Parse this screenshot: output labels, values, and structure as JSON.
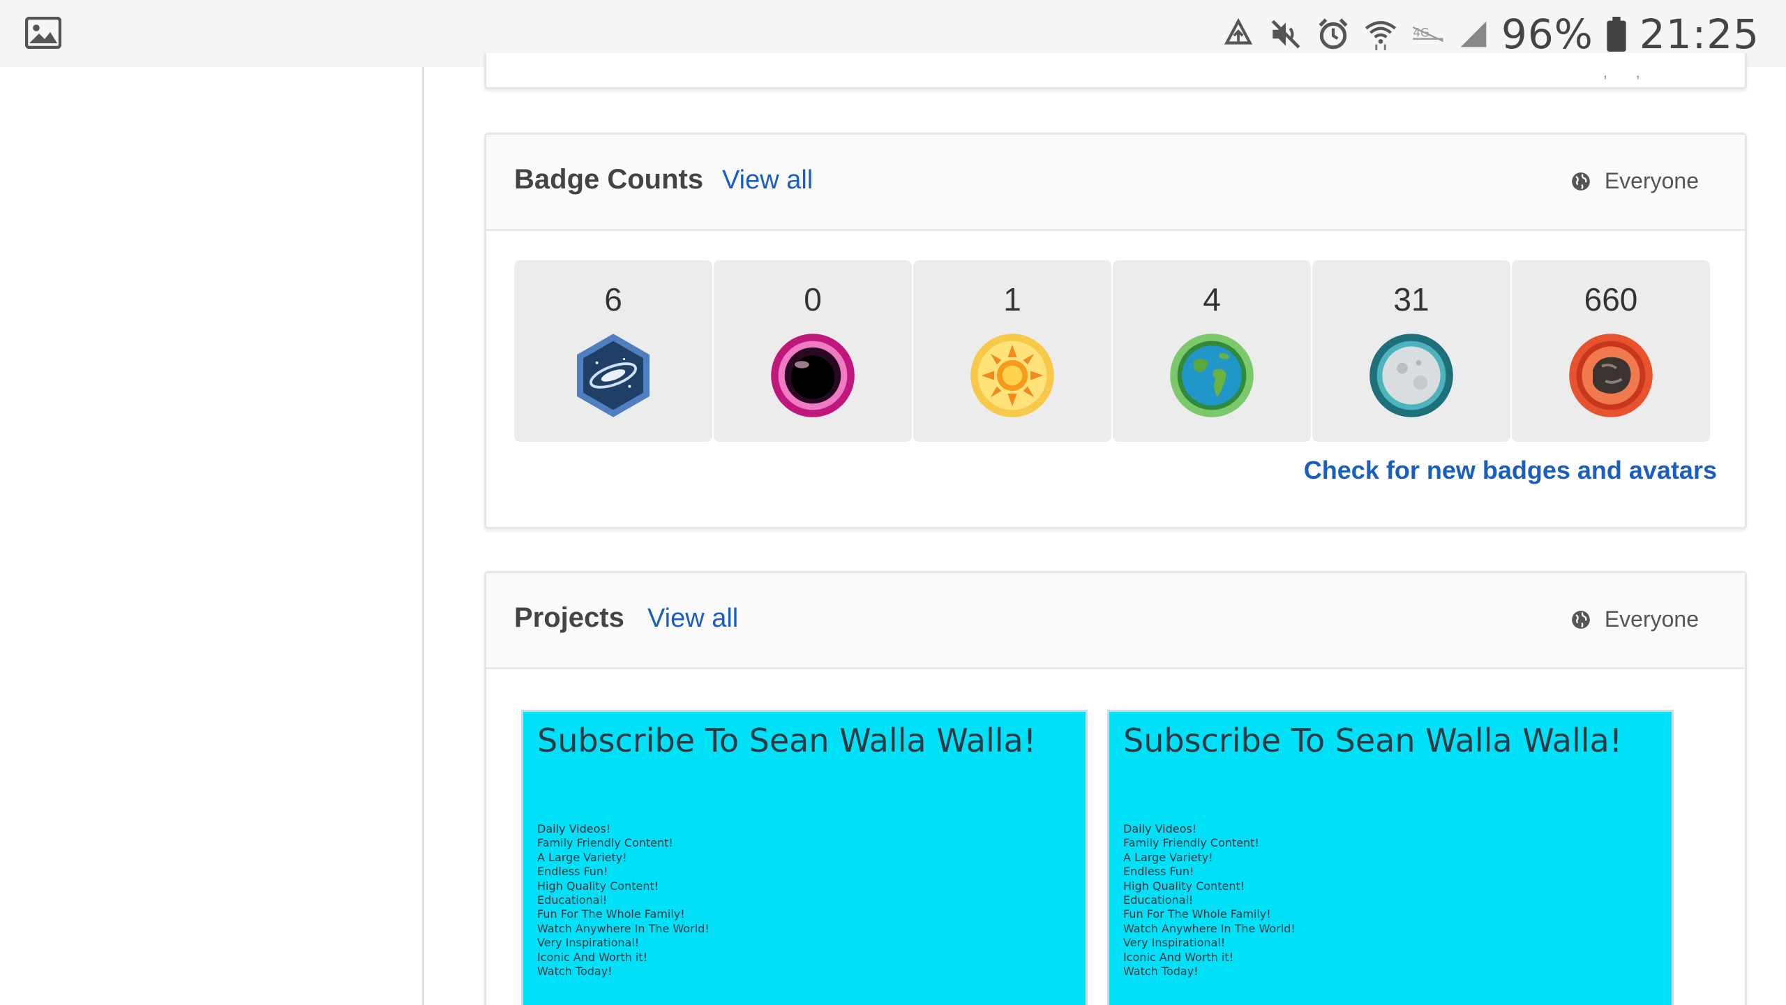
{
  "status_bar": {
    "icons": [
      "gallery-icon",
      "data-saver-icon",
      "mute-icon",
      "alarm-icon",
      "wifi-icon",
      "volte-icon",
      "signal-icon",
      "battery-icon"
    ],
    "battery": "96%",
    "time": "21:25"
  },
  "badge_counts": {
    "title": "Badge Counts",
    "view_all": "View all",
    "privacy": "Everyone",
    "badges": [
      {
        "count": "6",
        "icon": "black-hole-badge-icon",
        "color": "#3d6fa8"
      },
      {
        "count": "0",
        "icon": "nebula-badge-icon",
        "color": "#d1218d"
      },
      {
        "count": "1",
        "icon": "sun-badge-icon",
        "color": "#fbb917"
      },
      {
        "count": "4",
        "icon": "earth-badge-icon",
        "color": "#4caf50"
      },
      {
        "count": "31",
        "icon": "moon-badge-icon",
        "color": "#1d6f7a"
      },
      {
        "count": "660",
        "icon": "meteorite-badge-icon",
        "color": "#e8532f"
      }
    ],
    "check_link": "Check for new badges and avatars"
  },
  "projects": {
    "title": "Projects",
    "view_all": "View all",
    "privacy": "Everyone",
    "items": [
      {
        "title": "Subscribe To Sean Walla Walla!",
        "lines": [
          "Daily Videos!",
          "Family Friendly Content!",
          "A Large Variety!",
          "Endless Fun!",
          "High Quality Content!",
          "Educational!",
          "Fun For The Whole Family!",
          "Watch Anywhere In The World!",
          "Very Inspirational!",
          "Iconic And Worth it!",
          "Watch Today!"
        ],
        "background": "#00e1f7"
      },
      {
        "title": "Subscribe To Sean Walla Walla!",
        "lines": [
          "Daily Videos!",
          "Family Friendly Content!",
          "A Large Variety!",
          "Endless Fun!",
          "High Quality Content!",
          "Educational!",
          "Fun For The Whole Family!",
          "Watch Anywhere In The World!",
          "Very Inspirational!",
          "Iconic And Worth it!",
          "Watch Today!"
        ],
        "background": "#00e1f7"
      }
    ]
  }
}
